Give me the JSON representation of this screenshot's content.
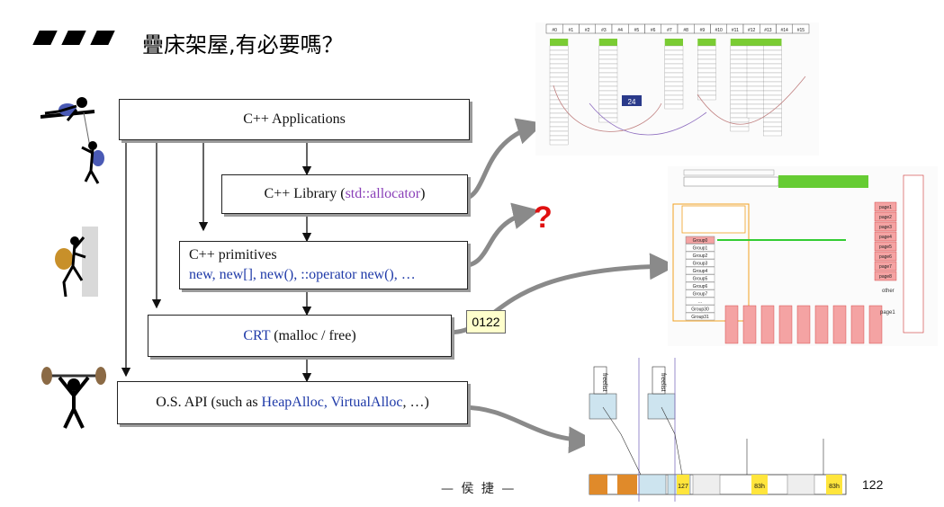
{
  "title": "疊床架屋,有必要嗎？",
  "boxes": {
    "app": "C++ Applications",
    "library_prefix": "C++ Library (",
    "library_em": "std::allocator",
    "library_suffix": ")",
    "primitives_line1": "C++ primitives",
    "primitives_line2": "new, new[], new(), ::operator new(), …",
    "crt_em": "CRT",
    "crt_rest": " (malloc / free)",
    "os_prefix": "O.S. API (such as ",
    "os_em": "HeapAlloc, VirtualAlloc",
    "os_suffix": ", …)"
  },
  "note": "0122",
  "question_mark": "?",
  "footer": "— 侯 捷 —",
  "page_number": "122",
  "colors": {
    "purple": "#8a3fb8",
    "blue": "#1f3aa8",
    "red": "#e01010",
    "arrow_gray": "#8a8a8a"
  },
  "thumbnails": {
    "top": {
      "headers": [
        "#0",
        "#1",
        "#2",
        "#3",
        "#4",
        "#5",
        "#6",
        "#7",
        "#8",
        "#9",
        "#10",
        "#11",
        "#12",
        "#13",
        "#14",
        "#15"
      ],
      "highlight": "24"
    },
    "middle": {
      "groups": [
        "Group0",
        "Group1",
        "Group2",
        "Group3",
        "Group4",
        "Group5",
        "Group6",
        "Group7",
        "...",
        "Group30",
        "Group31"
      ],
      "pages": [
        "page1",
        "page2",
        "page3",
        "page4",
        "page5",
        "page6",
        "page7",
        "page8"
      ],
      "other": "other",
      "other_pages": "page1"
    },
    "bottom": {
      "labels": [
        "freelist",
        "freelist"
      ],
      "cell_values": [
        "127",
        "83h",
        "83h"
      ]
    }
  }
}
